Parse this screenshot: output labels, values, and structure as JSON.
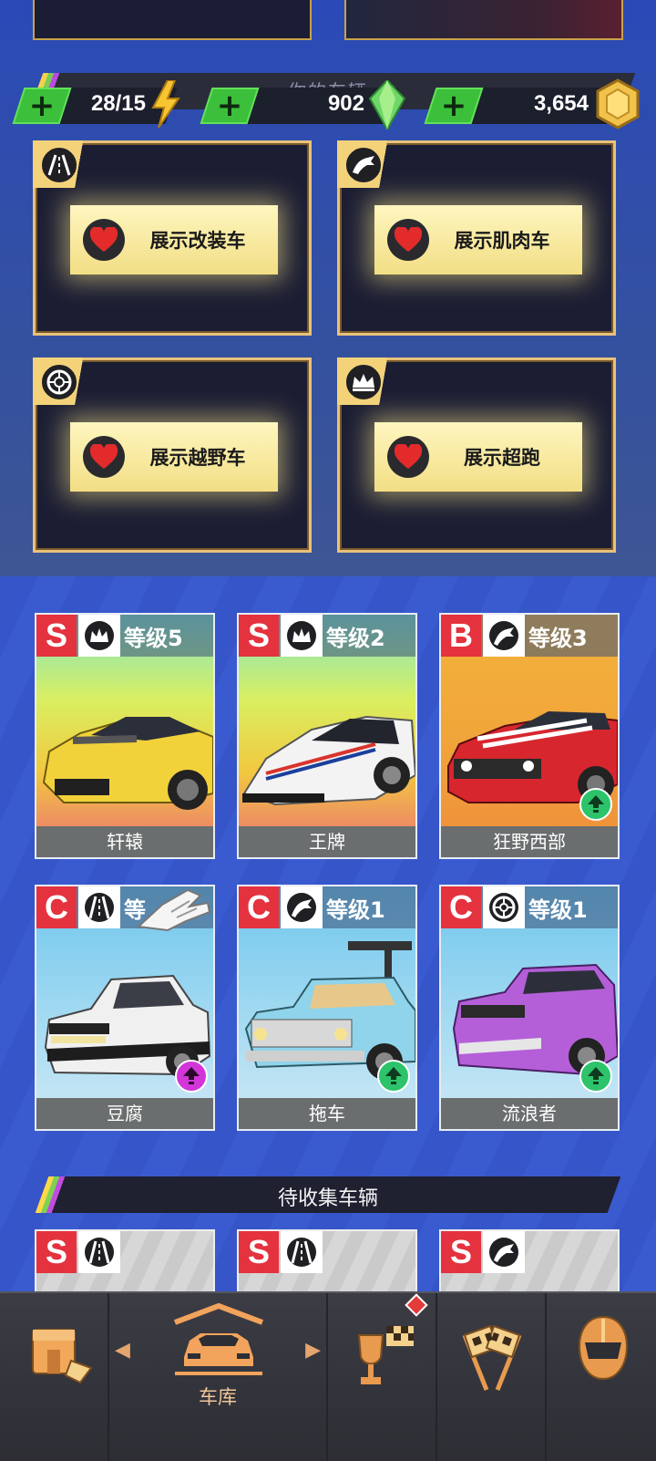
{
  "currency": {
    "energy": "28/15",
    "gems": "902",
    "coins": "3,654",
    "plus_label": "+"
  },
  "garage_banner": {
    "title": "你的车辆"
  },
  "showcase_slots": [
    {
      "label": "展示改装车",
      "icon": "road-icon"
    },
    {
      "label": "展示肌肉车",
      "icon": "horse-icon"
    },
    {
      "label": "展示越野车",
      "icon": "tire-icon"
    },
    {
      "label": "展示超跑",
      "icon": "crown-icon"
    }
  ],
  "cars": [
    {
      "class": "S",
      "type_icon": "crown-icon",
      "level": "等级5",
      "name": "轩辕",
      "color": "#f2d23a",
      "upgrade": false
    },
    {
      "class": "S",
      "type_icon": "crown-icon",
      "level": "等级2",
      "name": "王牌",
      "color": "#f2f2f2",
      "upgrade": false
    },
    {
      "class": "B",
      "type_icon": "horse-icon",
      "level": "等级3",
      "name": "狂野西部",
      "color": "#d8262e",
      "upgrade": true
    },
    {
      "class": "C",
      "type_icon": "road-icon",
      "level": "等",
      "name": "豆腐",
      "color": "#f0f0f0",
      "upgrade": true
    },
    {
      "class": "C",
      "type_icon": "horse-icon",
      "level": "等级1",
      "name": "拖车",
      "color": "#8fd4ea",
      "upgrade": true
    },
    {
      "class": "C",
      "type_icon": "tire-icon",
      "level": "等级1",
      "name": "流浪者",
      "color": "#b45fd8",
      "upgrade": true
    }
  ],
  "pending_section": {
    "title": "待收集车辆"
  },
  "pending_cars": [
    {
      "class": "S",
      "type_icon": "road-icon"
    },
    {
      "class": "S",
      "type_icon": "road-icon"
    },
    {
      "class": "S",
      "type_icon": "horse-icon"
    }
  ],
  "nav": {
    "garage_label": "车库",
    "items": [
      "shop-icon",
      "garage-icon",
      "trophy-flag-icon",
      "race-flags-icon",
      "helmet-icon"
    ]
  },
  "colors": {
    "accent_gold": "#e8c27a",
    "class_red": "#e4323f",
    "upgrade_green": "#2cc36b",
    "background_blue": "#2f4fbf"
  }
}
